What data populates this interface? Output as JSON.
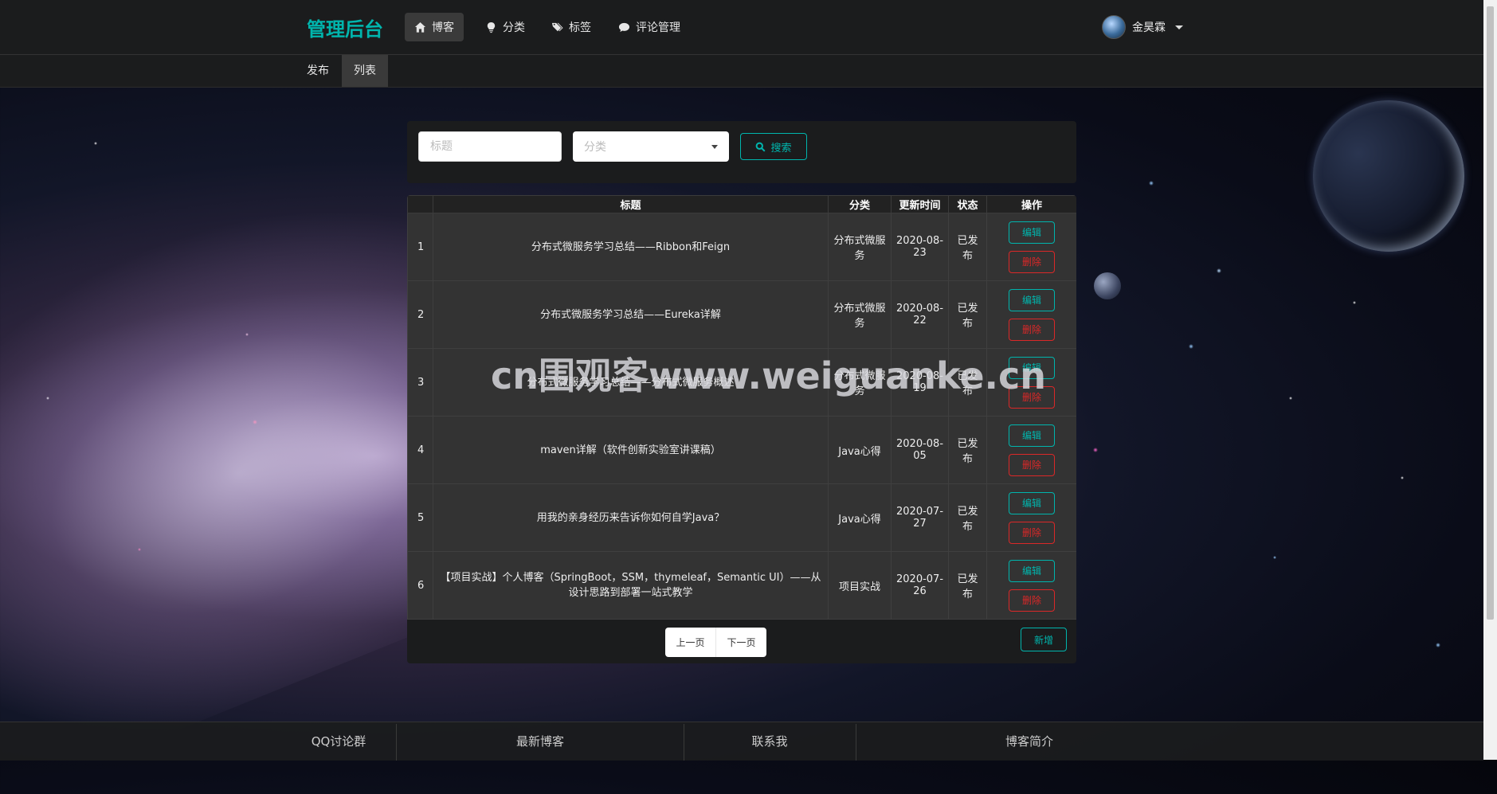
{
  "header": {
    "brand": "管理后台",
    "nav": [
      {
        "label": "博客",
        "icon": "home-icon",
        "active": true
      },
      {
        "label": "分类",
        "icon": "lightbulb-icon",
        "active": false
      },
      {
        "label": "标签",
        "icon": "tags-icon",
        "active": false
      },
      {
        "label": "评论管理",
        "icon": "comment-icon",
        "active": false
      }
    ],
    "user_name": "金昊霖"
  },
  "subnav": [
    {
      "label": "发布",
      "active": false
    },
    {
      "label": "列表",
      "active": true
    }
  ],
  "search": {
    "title_placeholder": "标题",
    "category_placeholder": "分类",
    "button_label": "搜索"
  },
  "table": {
    "headers": [
      "",
      "标题",
      "分类",
      "更新时间",
      "状态",
      "操作"
    ],
    "rows": [
      {
        "num": "1",
        "title": "分布式微服务学习总结——Ribbon和Feign",
        "category": "分布式微服务",
        "date": "2020-08-23",
        "status": "已发布"
      },
      {
        "num": "2",
        "title": "分布式微服务学习总结——Eureka详解",
        "category": "分布式微服务",
        "date": "2020-08-22",
        "status": "已发布"
      },
      {
        "num": "3",
        "title": "分布式微服务学习总结——分布式微服务概述",
        "category": "分布式微服务",
        "date": "2020-08-19",
        "status": "已发布"
      },
      {
        "num": "4",
        "title": "maven详解（软件创新实验室讲课稿）",
        "category": "Java心得",
        "date": "2020-08-05",
        "status": "已发布"
      },
      {
        "num": "5",
        "title": "用我的亲身经历来告诉你如何自学Java？",
        "category": "Java心得",
        "date": "2020-07-27",
        "status": "已发布"
      },
      {
        "num": "6",
        "title": "【项目实战】个人博客（SpringBoot，SSM，thymeleaf，Semantic UI）——从设计思路到部署一站式教学",
        "category": "项目实战",
        "date": "2020-07-26",
        "status": "已发布"
      }
    ],
    "edit_label": "编辑",
    "delete_label": "删除"
  },
  "pagination": {
    "prev_label": "上一页",
    "next_label": "下一页"
  },
  "new_button_label": "新增",
  "watermark": "cn围观客www.weiguanke.cn",
  "footer": [
    "QQ讨论群",
    "最新博客",
    "联系我",
    "博客简介"
  ],
  "colors": {
    "accent": "#00b5ad",
    "danger": "#db2828",
    "topbar": "#1b1c1d"
  }
}
